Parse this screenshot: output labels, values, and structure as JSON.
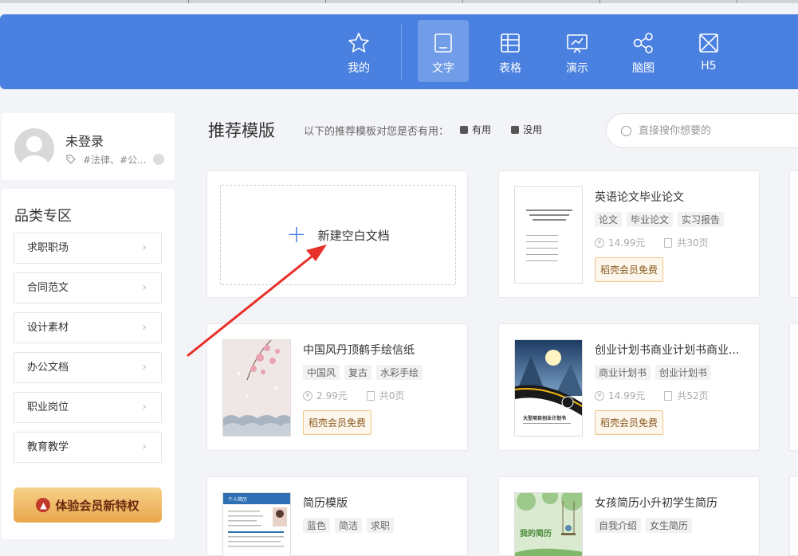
{
  "nav": {
    "items": [
      {
        "label": "我的",
        "icon": "star-icon"
      },
      {
        "label": "文字",
        "icon": "document-icon",
        "active": true
      },
      {
        "label": "表格",
        "icon": "table-icon"
      },
      {
        "label": "演示",
        "icon": "presentation-icon"
      },
      {
        "label": "脑图",
        "icon": "mindmap-icon"
      },
      {
        "label": "H5",
        "icon": "h5-icon"
      }
    ]
  },
  "user": {
    "name": "未登录",
    "tags": "#法律、#公..."
  },
  "categories": {
    "title": "品类专区",
    "items": [
      "求职职场",
      "合同范文",
      "设计素材",
      "办公文档",
      "职业岗位",
      "教育教学"
    ],
    "vip_button": "体验会员新特权"
  },
  "main": {
    "title": "推荐模版",
    "feedback_question": "以下的推荐模板对您是否有用：",
    "useful_label": "有用",
    "useless_label": "没用",
    "search_placeholder": "直接搜你想要的",
    "new_doc_label": "新建空白文档"
  },
  "templates": [
    {
      "title": "英语论文毕业论文",
      "tags": [
        "论文",
        "毕业论文",
        "实习报告"
      ],
      "price": "14.99元",
      "pages": "共30页",
      "vip": "稻壳会员免费"
    },
    {
      "title": "中国风丹顶鹤手绘信纸",
      "tags": [
        "中国风",
        "复古",
        "水彩手绘"
      ],
      "price": "2.99元",
      "pages": "共0页",
      "vip": "稻壳会员免费"
    },
    {
      "title": "创业计划书商业计划书商业...",
      "tags": [
        "商业计划书",
        "创业计划书"
      ],
      "price": "14.99元",
      "pages": "共52页",
      "vip": "稻壳会员免费"
    },
    {
      "title": "简历模版",
      "tags": [
        "蓝色",
        "简洁",
        "求职"
      ],
      "price": "",
      "pages": "",
      "vip": ""
    },
    {
      "title": "女孩简历小升初学生简历",
      "tags": [
        "自我介绍",
        "女生简历"
      ],
      "price": "",
      "pages": "",
      "vip": ""
    }
  ],
  "thumbnail_text": {
    "business_plan": "大型项目创业计划书",
    "resume_header": "个人简历",
    "girl_resume": "我的简历"
  },
  "colors": {
    "header_bg": "#4a80e0",
    "arrow": "#e8302a",
    "vip_gold": "#e9a64c"
  }
}
